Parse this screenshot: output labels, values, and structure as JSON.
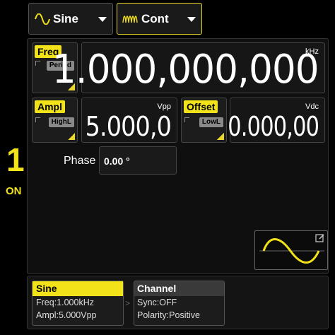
{
  "toolbar": {
    "waveform_label": "Sine",
    "mode_label": "Cont"
  },
  "channel": {
    "number": "1",
    "state": "ON"
  },
  "freq": {
    "key_label": "Freq",
    "alt_label": "Period",
    "unit": "kHz",
    "value": "1.000,000,000"
  },
  "ampl": {
    "key_label": "Ampl",
    "alt_label": "HighL",
    "unit": "Vpp",
    "value": "5.000,0"
  },
  "offset": {
    "key_label": "Offset",
    "alt_label": "LowL",
    "unit": "Vdc",
    "value": "0.000,00"
  },
  "phase": {
    "label": "Phase",
    "value": "0.00 °"
  },
  "info": {
    "sine": {
      "title": "Sine",
      "line1": "Freq:1.000kHz",
      "line2": "Ampl:5.000Vpp"
    },
    "separator": ">",
    "channel": {
      "title": "Channel",
      "line1": "Sync:OFF",
      "line2": "Polarity:Positive"
    }
  },
  "colors": {
    "accent": "#f2e21a",
    "background": "#000000"
  },
  "icons": [
    "sine-wave-icon",
    "pulse-train-icon",
    "edit-icon"
  ]
}
